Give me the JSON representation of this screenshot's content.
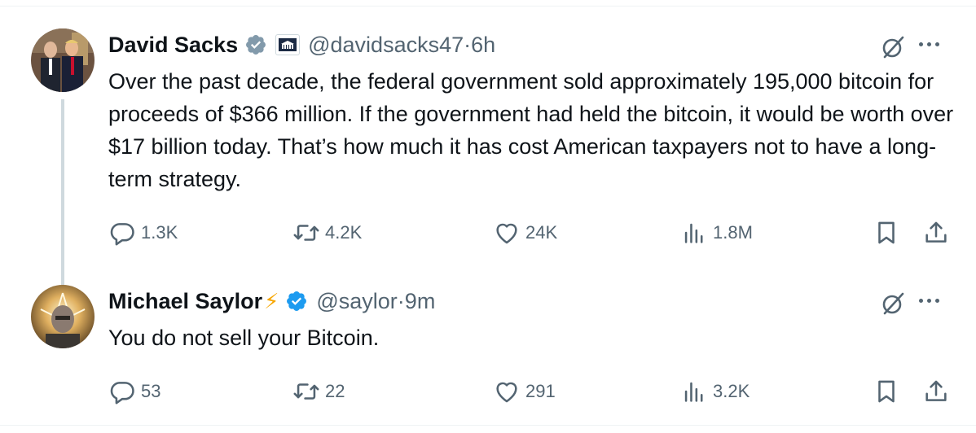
{
  "tweets": [
    {
      "author_name": "David Sacks",
      "handle": "@davidsacks47",
      "time": "6h",
      "text": "Over the past decade, the federal government sold approximately 195,000 bitcoin for proceeds of $366 million. If the government had held the bitcoin, it would be worth over $17 billion today. That’s how much it has cost American taxpayers not to have a long-term strategy.",
      "verified_color": "#829aab",
      "has_affiliation_badge": true,
      "metrics": {
        "replies": "1.3K",
        "reposts": "4.2K",
        "likes": "24K",
        "views": "1.8M"
      }
    },
    {
      "author_name": "Michael Saylor",
      "name_emoji": "⚡",
      "handle": "@saylor",
      "time": "9m",
      "text": "You do not sell your Bitcoin.",
      "verified_color": "#1d9bf0",
      "metrics": {
        "replies": "53",
        "reposts": "22",
        "likes": "291",
        "views": "3.2K"
      }
    }
  ],
  "separator": " · ",
  "colors": {
    "text": "#0f1419",
    "secondary": "#536471",
    "thread_line": "#cfd9de",
    "accent": "#1d9bf0"
  },
  "icons": [
    "verified-badge-icon",
    "white-house-affiliation-icon",
    "grok-icon",
    "more-icon",
    "reply-icon",
    "repost-icon",
    "like-icon",
    "views-icon",
    "bookmark-icon",
    "share-icon"
  ]
}
